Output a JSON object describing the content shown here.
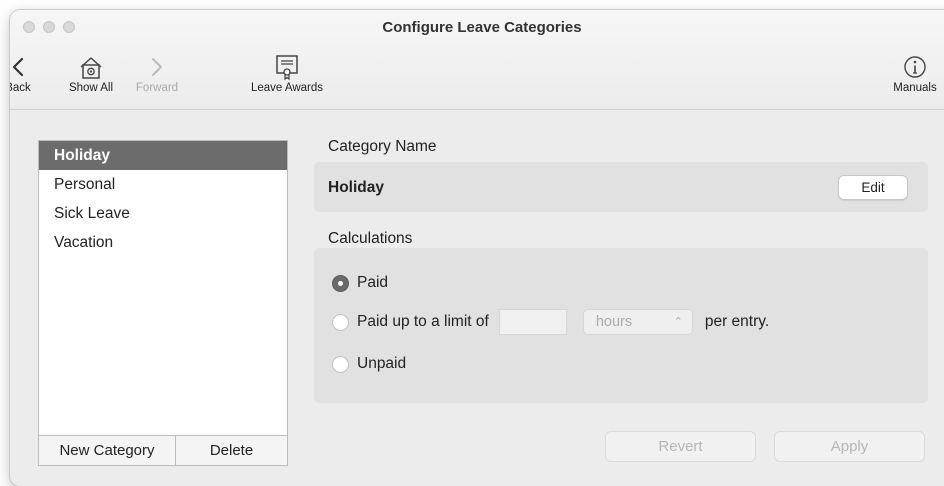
{
  "window": {
    "title": "Configure Leave Categories"
  },
  "toolbar": {
    "back": "Back",
    "show_all": "Show All",
    "forward": "Forward",
    "leave_awards": "Leave Awards",
    "manuals": "Manuals"
  },
  "categories": {
    "items": [
      "Holiday",
      "Personal",
      "Sick Leave",
      "Vacation"
    ],
    "selected": "Holiday",
    "new_button": "New Category",
    "delete_button": "Delete"
  },
  "detail": {
    "category_name_label": "Category Name",
    "category_name_value": "Holiday",
    "edit_button": "Edit",
    "calculations_label": "Calculations",
    "options": {
      "paid": "Paid",
      "paid_limit_prefix": "Paid up to a limit of",
      "limit_value": "",
      "unit": "hours",
      "paid_limit_suffix": "per entry.",
      "unpaid": "Unpaid"
    },
    "selected_option": "paid",
    "revert_button": "Revert",
    "apply_button": "Apply"
  }
}
